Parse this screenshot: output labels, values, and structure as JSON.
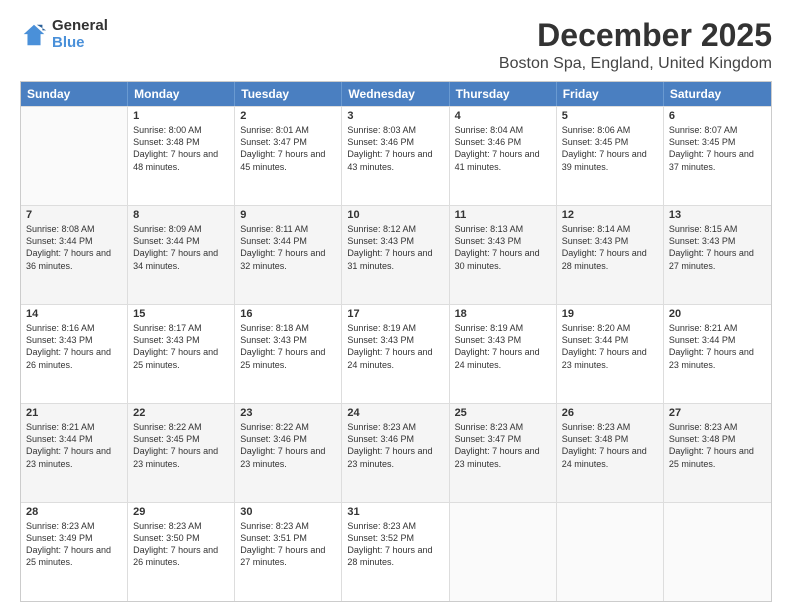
{
  "logo": {
    "general": "General",
    "blue": "Blue"
  },
  "header": {
    "month": "December 2025",
    "location": "Boston Spa, England, United Kingdom"
  },
  "weekdays": [
    "Sunday",
    "Monday",
    "Tuesday",
    "Wednesday",
    "Thursday",
    "Friday",
    "Saturday"
  ],
  "rows": [
    [
      {
        "day": "",
        "sunrise": "",
        "sunset": "",
        "daylight": "",
        "shaded": false,
        "empty": true
      },
      {
        "day": "1",
        "sunrise": "Sunrise: 8:00 AM",
        "sunset": "Sunset: 3:48 PM",
        "daylight": "Daylight: 7 hours and 48 minutes.",
        "shaded": false,
        "empty": false
      },
      {
        "day": "2",
        "sunrise": "Sunrise: 8:01 AM",
        "sunset": "Sunset: 3:47 PM",
        "daylight": "Daylight: 7 hours and 45 minutes.",
        "shaded": false,
        "empty": false
      },
      {
        "day": "3",
        "sunrise": "Sunrise: 8:03 AM",
        "sunset": "Sunset: 3:46 PM",
        "daylight": "Daylight: 7 hours and 43 minutes.",
        "shaded": false,
        "empty": false
      },
      {
        "day": "4",
        "sunrise": "Sunrise: 8:04 AM",
        "sunset": "Sunset: 3:46 PM",
        "daylight": "Daylight: 7 hours and 41 minutes.",
        "shaded": false,
        "empty": false
      },
      {
        "day": "5",
        "sunrise": "Sunrise: 8:06 AM",
        "sunset": "Sunset: 3:45 PM",
        "daylight": "Daylight: 7 hours and 39 minutes.",
        "shaded": false,
        "empty": false
      },
      {
        "day": "6",
        "sunrise": "Sunrise: 8:07 AM",
        "sunset": "Sunset: 3:45 PM",
        "daylight": "Daylight: 7 hours and 37 minutes.",
        "shaded": false,
        "empty": false
      }
    ],
    [
      {
        "day": "7",
        "sunrise": "Sunrise: 8:08 AM",
        "sunset": "Sunset: 3:44 PM",
        "daylight": "Daylight: 7 hours and 36 minutes.",
        "shaded": true,
        "empty": false
      },
      {
        "day": "8",
        "sunrise": "Sunrise: 8:09 AM",
        "sunset": "Sunset: 3:44 PM",
        "daylight": "Daylight: 7 hours and 34 minutes.",
        "shaded": true,
        "empty": false
      },
      {
        "day": "9",
        "sunrise": "Sunrise: 8:11 AM",
        "sunset": "Sunset: 3:44 PM",
        "daylight": "Daylight: 7 hours and 32 minutes.",
        "shaded": true,
        "empty": false
      },
      {
        "day": "10",
        "sunrise": "Sunrise: 8:12 AM",
        "sunset": "Sunset: 3:43 PM",
        "daylight": "Daylight: 7 hours and 31 minutes.",
        "shaded": true,
        "empty": false
      },
      {
        "day": "11",
        "sunrise": "Sunrise: 8:13 AM",
        "sunset": "Sunset: 3:43 PM",
        "daylight": "Daylight: 7 hours and 30 minutes.",
        "shaded": true,
        "empty": false
      },
      {
        "day": "12",
        "sunrise": "Sunrise: 8:14 AM",
        "sunset": "Sunset: 3:43 PM",
        "daylight": "Daylight: 7 hours and 28 minutes.",
        "shaded": true,
        "empty": false
      },
      {
        "day": "13",
        "sunrise": "Sunrise: 8:15 AM",
        "sunset": "Sunset: 3:43 PM",
        "daylight": "Daylight: 7 hours and 27 minutes.",
        "shaded": true,
        "empty": false
      }
    ],
    [
      {
        "day": "14",
        "sunrise": "Sunrise: 8:16 AM",
        "sunset": "Sunset: 3:43 PM",
        "daylight": "Daylight: 7 hours and 26 minutes.",
        "shaded": false,
        "empty": false
      },
      {
        "day": "15",
        "sunrise": "Sunrise: 8:17 AM",
        "sunset": "Sunset: 3:43 PM",
        "daylight": "Daylight: 7 hours and 25 minutes.",
        "shaded": false,
        "empty": false
      },
      {
        "day": "16",
        "sunrise": "Sunrise: 8:18 AM",
        "sunset": "Sunset: 3:43 PM",
        "daylight": "Daylight: 7 hours and 25 minutes.",
        "shaded": false,
        "empty": false
      },
      {
        "day": "17",
        "sunrise": "Sunrise: 8:19 AM",
        "sunset": "Sunset: 3:43 PM",
        "daylight": "Daylight: 7 hours and 24 minutes.",
        "shaded": false,
        "empty": false
      },
      {
        "day": "18",
        "sunrise": "Sunrise: 8:19 AM",
        "sunset": "Sunset: 3:43 PM",
        "daylight": "Daylight: 7 hours and 24 minutes.",
        "shaded": false,
        "empty": false
      },
      {
        "day": "19",
        "sunrise": "Sunrise: 8:20 AM",
        "sunset": "Sunset: 3:44 PM",
        "daylight": "Daylight: 7 hours and 23 minutes.",
        "shaded": false,
        "empty": false
      },
      {
        "day": "20",
        "sunrise": "Sunrise: 8:21 AM",
        "sunset": "Sunset: 3:44 PM",
        "daylight": "Daylight: 7 hours and 23 minutes.",
        "shaded": false,
        "empty": false
      }
    ],
    [
      {
        "day": "21",
        "sunrise": "Sunrise: 8:21 AM",
        "sunset": "Sunset: 3:44 PM",
        "daylight": "Daylight: 7 hours and 23 minutes.",
        "shaded": true,
        "empty": false
      },
      {
        "day": "22",
        "sunrise": "Sunrise: 8:22 AM",
        "sunset": "Sunset: 3:45 PM",
        "daylight": "Daylight: 7 hours and 23 minutes.",
        "shaded": true,
        "empty": false
      },
      {
        "day": "23",
        "sunrise": "Sunrise: 8:22 AM",
        "sunset": "Sunset: 3:46 PM",
        "daylight": "Daylight: 7 hours and 23 minutes.",
        "shaded": true,
        "empty": false
      },
      {
        "day": "24",
        "sunrise": "Sunrise: 8:23 AM",
        "sunset": "Sunset: 3:46 PM",
        "daylight": "Daylight: 7 hours and 23 minutes.",
        "shaded": true,
        "empty": false
      },
      {
        "day": "25",
        "sunrise": "Sunrise: 8:23 AM",
        "sunset": "Sunset: 3:47 PM",
        "daylight": "Daylight: 7 hours and 23 minutes.",
        "shaded": true,
        "empty": false
      },
      {
        "day": "26",
        "sunrise": "Sunrise: 8:23 AM",
        "sunset": "Sunset: 3:48 PM",
        "daylight": "Daylight: 7 hours and 24 minutes.",
        "shaded": true,
        "empty": false
      },
      {
        "day": "27",
        "sunrise": "Sunrise: 8:23 AM",
        "sunset": "Sunset: 3:48 PM",
        "daylight": "Daylight: 7 hours and 25 minutes.",
        "shaded": true,
        "empty": false
      }
    ],
    [
      {
        "day": "28",
        "sunrise": "Sunrise: 8:23 AM",
        "sunset": "Sunset: 3:49 PM",
        "daylight": "Daylight: 7 hours and 25 minutes.",
        "shaded": false,
        "empty": false
      },
      {
        "day": "29",
        "sunrise": "Sunrise: 8:23 AM",
        "sunset": "Sunset: 3:50 PM",
        "daylight": "Daylight: 7 hours and 26 minutes.",
        "shaded": false,
        "empty": false
      },
      {
        "day": "30",
        "sunrise": "Sunrise: 8:23 AM",
        "sunset": "Sunset: 3:51 PM",
        "daylight": "Daylight: 7 hours and 27 minutes.",
        "shaded": false,
        "empty": false
      },
      {
        "day": "31",
        "sunrise": "Sunrise: 8:23 AM",
        "sunset": "Sunset: 3:52 PM",
        "daylight": "Daylight: 7 hours and 28 minutes.",
        "shaded": false,
        "empty": false
      },
      {
        "day": "",
        "sunrise": "",
        "sunset": "",
        "daylight": "",
        "shaded": false,
        "empty": true
      },
      {
        "day": "",
        "sunrise": "",
        "sunset": "",
        "daylight": "",
        "shaded": false,
        "empty": true
      },
      {
        "day": "",
        "sunrise": "",
        "sunset": "",
        "daylight": "",
        "shaded": false,
        "empty": true
      }
    ]
  ]
}
